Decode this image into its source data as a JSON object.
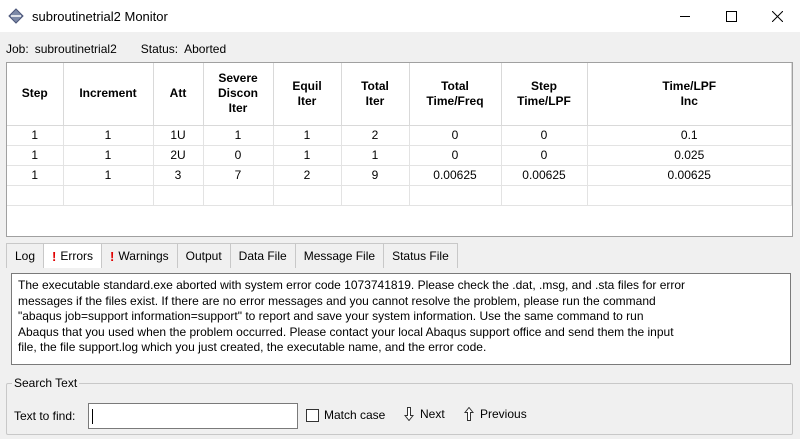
{
  "window": {
    "title": "subroutinetrial2 Monitor",
    "icons": {
      "app": "abaqus-diamond-icon",
      "minimize": "minimize-icon",
      "maximize": "maximize-icon",
      "close": "close-icon"
    }
  },
  "job": {
    "label": "Job:",
    "name": "subroutinetrial2",
    "status_label": "Status:",
    "status": "Aborted"
  },
  "table": {
    "headers": [
      [
        "Step"
      ],
      [
        "Increment"
      ],
      [
        "Att"
      ],
      [
        "Severe",
        "Discon",
        "Iter"
      ],
      [
        "Equil",
        "Iter"
      ],
      [
        "Total",
        "Iter"
      ],
      [
        "Total",
        "Time/Freq"
      ],
      [
        "Step",
        "Time/LPF"
      ],
      [
        "Time/LPF",
        "Inc"
      ]
    ],
    "rows": [
      [
        "1",
        "1",
        "1U",
        "1",
        "1",
        "2",
        "0",
        "0",
        "0.1"
      ],
      [
        "1",
        "1",
        "2U",
        "0",
        "1",
        "1",
        "0",
        "0",
        "0.025"
      ],
      [
        "1",
        "1",
        "3",
        "7",
        "2",
        "9",
        "0.00625",
        "0.00625",
        "0.00625"
      ],
      [
        "",
        "",
        "",
        "",
        "",
        "",
        "",
        "",
        ""
      ]
    ]
  },
  "tabs": [
    {
      "label": "Log",
      "marker": "",
      "active": false
    },
    {
      "label": "Errors",
      "marker": "!",
      "active": true
    },
    {
      "label": "Warnings",
      "marker": "!",
      "active": false
    },
    {
      "label": "Output",
      "marker": "",
      "active": false
    },
    {
      "label": "Data File",
      "marker": "",
      "active": false
    },
    {
      "label": "Message File",
      "marker": "",
      "active": false
    },
    {
      "label": "Status File",
      "marker": "",
      "active": false
    }
  ],
  "error_message": [
    "The executable standard.exe aborted with system error code 1073741819. Please check the .dat, .msg, and .sta files for error",
    "messages if the files exist.  If there are no error messages and you cannot resolve the problem, please run the command",
    "\"abaqus job=support information=support\" to report and save your system information.  Use the same command to run",
    "Abaqus that you used when the problem occurred.  Please contact your local Abaqus support office and send them the input",
    "file, the file support.log which you just created, the executable name, and the error code."
  ],
  "search": {
    "group_label": "Search Text",
    "find_label": "Text to find:",
    "find_value": "",
    "match_case_label": "Match case",
    "match_case_checked": false,
    "next_label": "Next",
    "previous_label": "Previous",
    "icons": {
      "next": "arrow-down-icon",
      "previous": "arrow-up-icon"
    }
  },
  "colors": {
    "error_marker": "#e00000",
    "window_bg": "#f0f0f0"
  }
}
